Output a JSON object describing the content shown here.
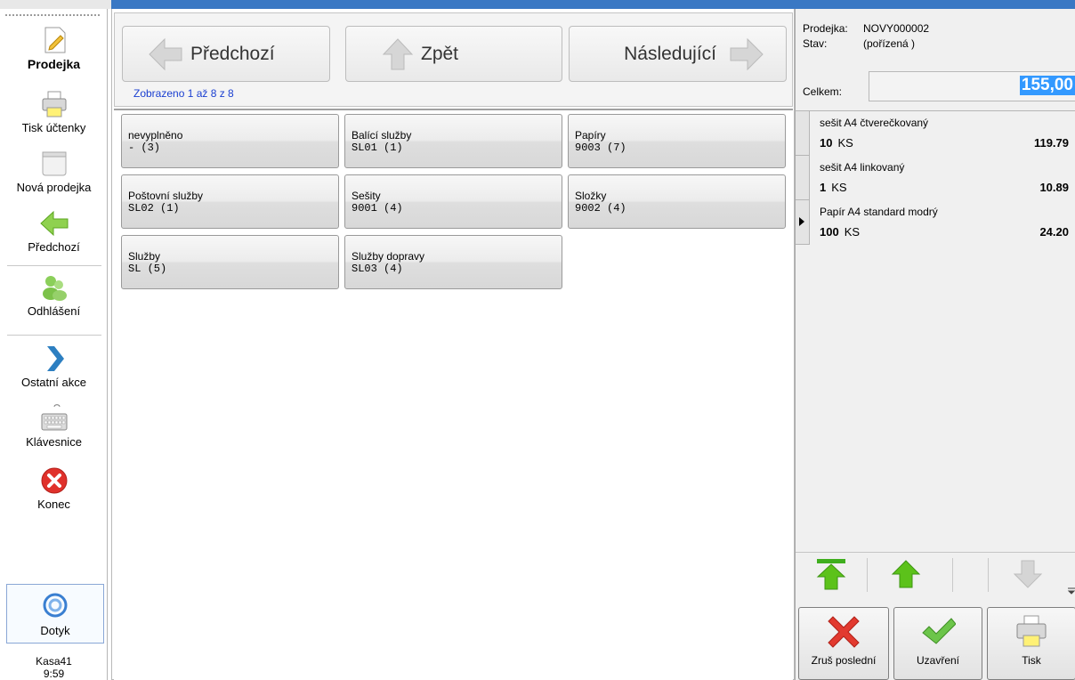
{
  "sidebar": {
    "items": [
      {
        "label": "Prodejka",
        "icon": "pencil-icon"
      },
      {
        "label": "Tisk účtenky",
        "icon": "printer-icon"
      },
      {
        "label": "Nová prodejka",
        "icon": "blank-page-icon"
      },
      {
        "label": "Předchozí",
        "icon": "arrow-left-icon"
      },
      {
        "label": "Odhlášení",
        "icon": "users-icon"
      },
      {
        "label": "Ostatní akce",
        "icon": "chevron-right-icon"
      },
      {
        "label": "Klávesnice",
        "icon": "keyboard-icon"
      },
      {
        "label": "Konec",
        "icon": "exit-icon"
      }
    ],
    "touch_label": "Dotyk",
    "register": "Kasa41",
    "time": "9:59"
  },
  "nav": {
    "prev": "Předchozí",
    "back": "Zpět",
    "next": "Následující",
    "shown_text": "Zobrazeno 1 až 8 z 8"
  },
  "categories": [
    {
      "name": "nevyplněno",
      "code": "- (3)"
    },
    {
      "name": "Balící služby",
      "code": "SL01 (1)"
    },
    {
      "name": "Papíry",
      "code": "9003 (7)"
    },
    {
      "name": "Poštovní služby",
      "code": "SL02 (1)"
    },
    {
      "name": "Sešity",
      "code": "9001 (4)"
    },
    {
      "name": "Složky",
      "code": "9002 (4)"
    },
    {
      "name": "Služby",
      "code": "SL (5)"
    },
    {
      "name": "Služby dopravy",
      "code": "SL03 (4)"
    }
  ],
  "receipt": {
    "doc_label": "Prodejka:",
    "doc_number": "NOVY000002",
    "state_label": "Stav:",
    "state_value": "(pořízená )",
    "total_label": "Celkem:",
    "total_value": "155,00",
    "items": [
      {
        "name": "sešit A4 čtverečkovaný",
        "qty": "10",
        "unit": "KS",
        "price": "119.79",
        "selected": false
      },
      {
        "name": "sešit A4 linkovaný",
        "qty": "1",
        "unit": "KS",
        "price": "10.89",
        "selected": false
      },
      {
        "name": "Papír A4 standard modrý",
        "qty": "100",
        "unit": "KS",
        "price": "24.20",
        "selected": true
      }
    ]
  },
  "actions": {
    "cancel_last": "Zruš poslední",
    "close": "Uzavření",
    "print": "Tisk"
  },
  "colors": {
    "accent_blue": "#3a78c4",
    "highlight": "#3399ff",
    "green_arrow": "#5cc21a",
    "red_x": "#e0312b"
  }
}
